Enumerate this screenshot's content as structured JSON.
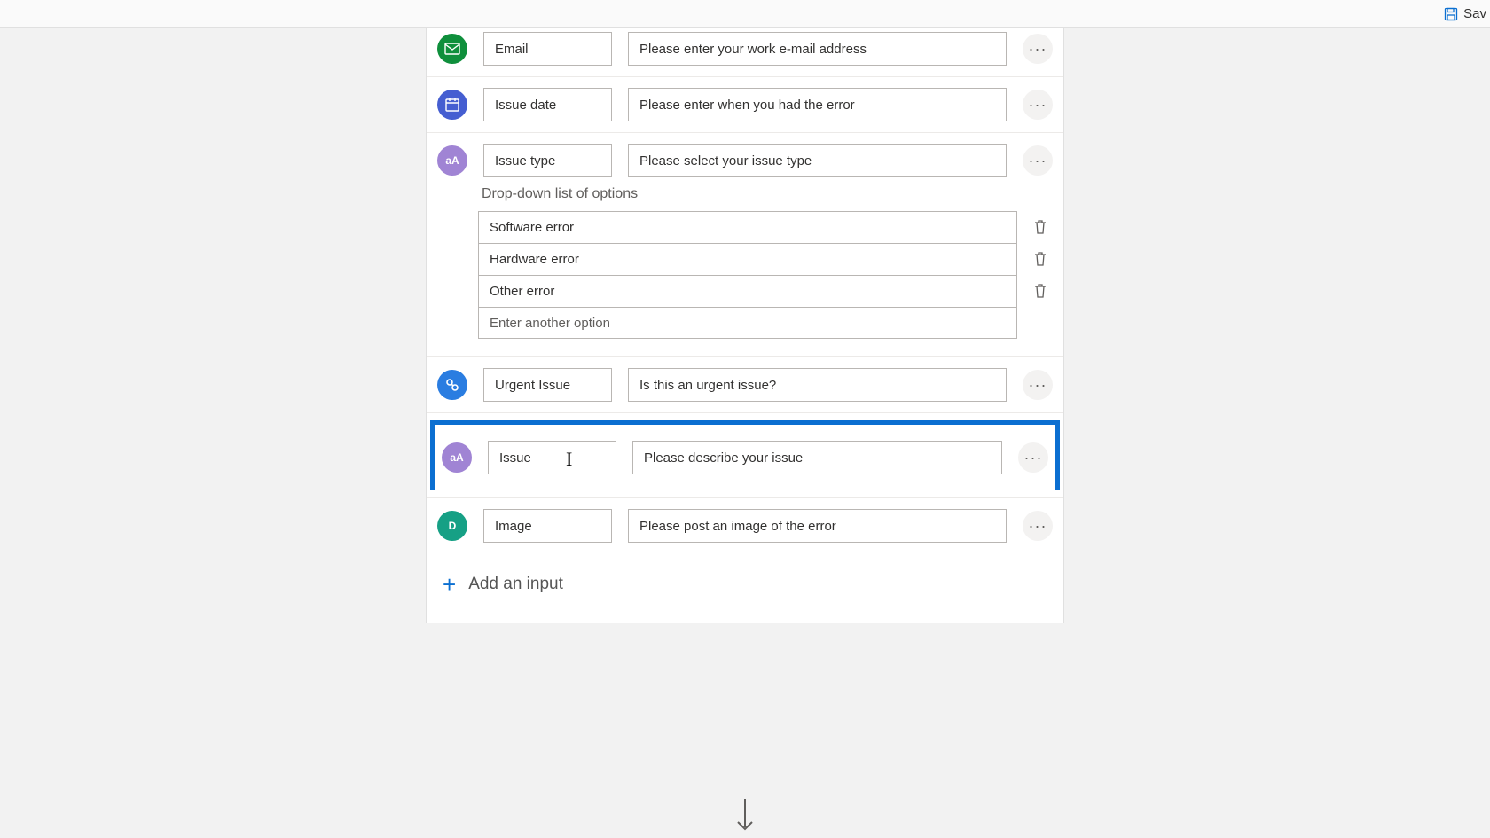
{
  "toolbar": {
    "save_label": "Sav"
  },
  "inputs": {
    "email": {
      "name": "Email",
      "prompt": "Please enter your work e-mail address"
    },
    "date": {
      "name": "Issue date",
      "prompt": "Please enter when you had the error"
    },
    "type": {
      "name": "Issue type",
      "prompt": "Please select your issue type",
      "dropdown_label": "Drop-down list of options",
      "options": [
        "Software error",
        "Hardware error",
        "Other error"
      ],
      "add_option_placeholder": "Enter another option"
    },
    "urgent": {
      "name": "Urgent Issue",
      "prompt": "Is this an urgent issue?"
    },
    "desc": {
      "name": "Issue",
      "prompt": "Please describe your issue"
    },
    "image": {
      "name": "Image",
      "prompt": "Please post an image of the error"
    }
  },
  "add_input_label": "Add an input",
  "icon_letters": {
    "text": "aA",
    "file": "D"
  }
}
